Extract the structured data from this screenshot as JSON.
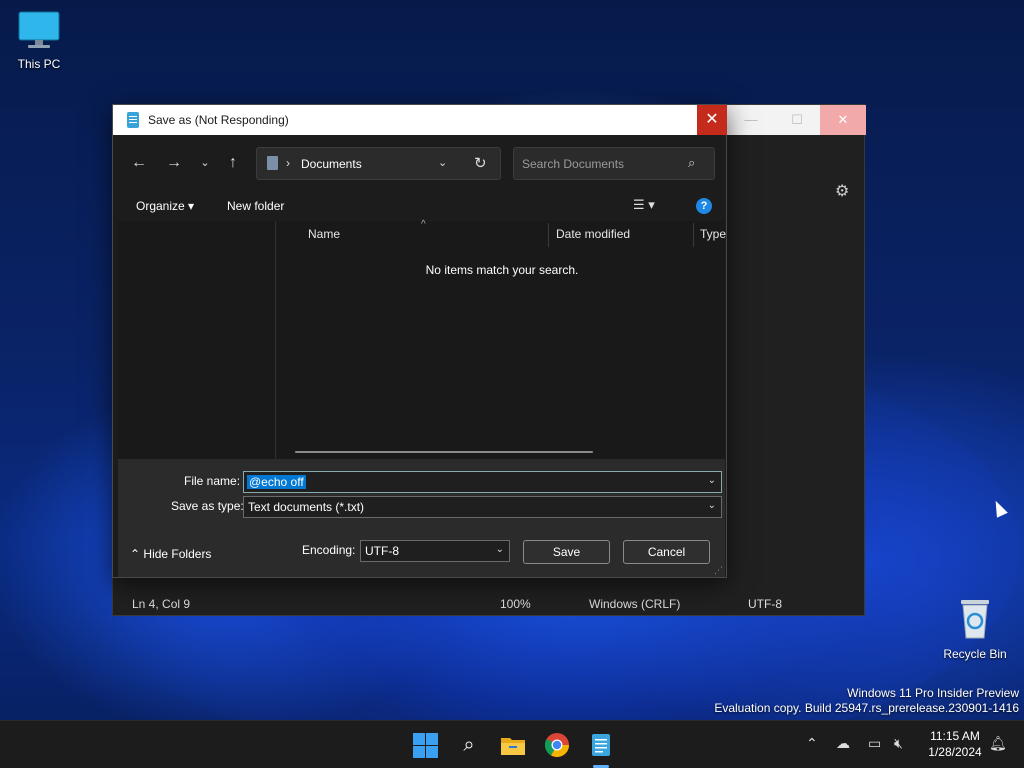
{
  "desktop": {
    "icons": [
      {
        "label": "This PC"
      },
      {
        "label": "Recycle Bin"
      }
    ],
    "watermark_line1": "Windows 11 Pro Insider Preview",
    "watermark_line2": "Evaluation copy. Build 25947.rs_prerelease.230901-1416"
  },
  "notepad": {
    "status": {
      "position": "Ln 4, Col 9",
      "zoom": "100%",
      "line_ending": "Windows (CRLF)",
      "encoding": "UTF-8"
    }
  },
  "dialog": {
    "title": "Save as (Not Responding)",
    "close_glyph": "✕",
    "breadcrumb": "Documents",
    "search_placeholder": "Search Documents",
    "commands": {
      "organize": "Organize ▾",
      "new_folder": "New folder"
    },
    "columns": [
      "Name",
      "Date modified",
      "Type"
    ],
    "empty_message": "No items match your search.",
    "file_name_label": "File name:",
    "file_name_value": "@echo off",
    "save_type_label": "Save as type:",
    "save_type_value": "Text documents (*.txt)",
    "hide_folders": "Hide Folders",
    "encoding_label": "Encoding:",
    "encoding_value": "UTF-8",
    "save_button": "Save",
    "cancel_button": "Cancel"
  },
  "taskbar": {
    "time": "11:15 AM",
    "date": "1/28/2024",
    "pinned": [
      "start-icon",
      "search-icon",
      "file-explorer-icon",
      "chrome-icon",
      "notepad-icon"
    ]
  },
  "colors": {
    "accent": "#0078d4",
    "close_red": "#c42b1c",
    "dark_bg": "#1c1c1c"
  }
}
